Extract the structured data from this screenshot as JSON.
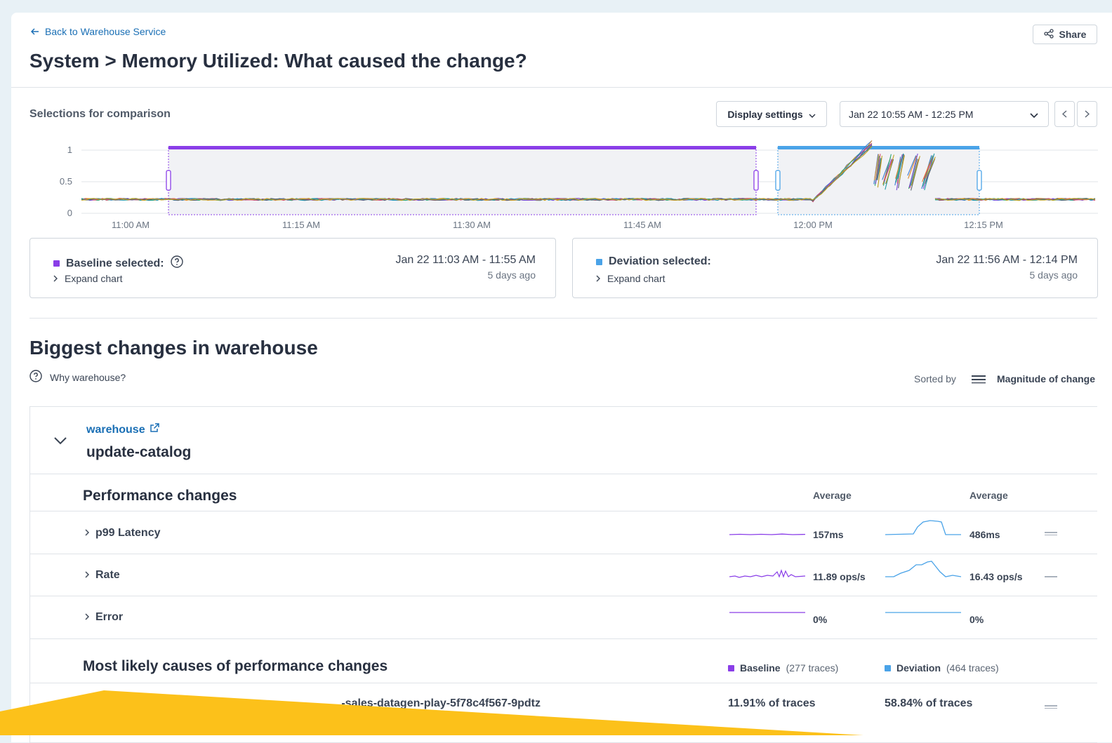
{
  "header": {
    "back_label": "Back to Warehouse Service",
    "title": "System > Memory Utilized: What caused the change?",
    "share_label": "Share"
  },
  "comparison": {
    "label": "Selections for comparison",
    "display_settings_label": "Display settings",
    "time_range": "Jan 22 10:55 AM - 12:25 PM"
  },
  "chart_data": {
    "type": "line",
    "x_ticks": [
      "11:00 AM",
      "11:15 AM",
      "11:30 AM",
      "11:45 AM",
      "12:00 PM",
      "12:15 PM"
    ],
    "y_ticks": [
      "0",
      "0.5",
      "1"
    ],
    "ylim": [
      0,
      1
    ],
    "grid": true,
    "baseline_window": [
      "11:03 AM",
      "11:55 AM"
    ],
    "deviation_window": [
      "11:56 AM",
      "12:14 PM"
    ],
    "colors": {
      "baseline": "#8a3ee8",
      "deviation": "#4aa3e8"
    }
  },
  "baseline": {
    "label": "Baseline selected:",
    "expand_label": "Expand chart",
    "range": "Jan 22 11:03 AM - 11:55 AM",
    "ago": "5 days ago",
    "color": "#8a3ee8"
  },
  "deviation": {
    "label": "Deviation selected:",
    "expand_label": "Expand chart",
    "range": "Jan 22 11:56 AM - 12:14 PM",
    "ago": "5 days ago",
    "color": "#4aa3e8"
  },
  "changes": {
    "title": "Biggest changes in warehouse",
    "why_label": "Why warehouse?",
    "sorted_by_label": "Sorted by",
    "sorted_by_value": "Magnitude of change"
  },
  "service": {
    "link": "warehouse",
    "operation": "update-catalog"
  },
  "performance": {
    "title": "Performance changes",
    "avg_label_baseline": "Average",
    "avg_label_deviation": "Average",
    "metrics": [
      {
        "name": "p99 Latency",
        "baseline": "157ms",
        "deviation": "486ms"
      },
      {
        "name": "Rate",
        "baseline": "11.89 ops/s",
        "deviation": "16.43 ops/s"
      },
      {
        "name": "Error",
        "baseline": "0%",
        "deviation": "0%"
      }
    ]
  },
  "causes": {
    "title": "Most likely causes of performance changes",
    "baseline_legend": "Baseline",
    "baseline_count": "(277 traces)",
    "deviation_legend": "Deviation",
    "deviation_count": "(464 traces)",
    "rows": [
      {
        "name": "...-sales-datagen-play-5f78c4f567-9pdtz",
        "baseline": "11.91% of traces",
        "deviation": "58.84% of traces"
      }
    ]
  }
}
